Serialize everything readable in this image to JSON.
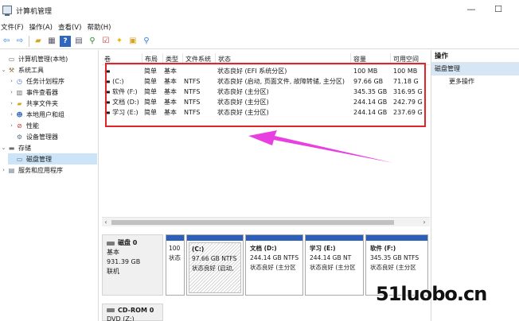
{
  "window": {
    "title": "计算机管理",
    "minimize": "—",
    "maximize": "☐"
  },
  "menu": [
    "文件(F)",
    "操作(A)",
    "查看(V)",
    "帮助(H)"
  ],
  "toolbar": [
    "back-icon",
    "forward-icon",
    "up-folder-icon",
    "show-tree-icon",
    "help-icon",
    "properties-icon",
    "connect-icon",
    "check-icon",
    "new-icon",
    "search-folder-icon",
    "zoom-icon"
  ],
  "nav": [
    {
      "label": "计算机管理(本地)",
      "level": 0,
      "arrow": "",
      "icon": "computer-icon"
    },
    {
      "label": "系统工具",
      "level": 1,
      "arrow": "⌄",
      "icon": "tools-icon"
    },
    {
      "label": "任务计划程序",
      "level": 2,
      "arrow": "›",
      "icon": "clock-icon"
    },
    {
      "label": "事件查看器",
      "level": 2,
      "arrow": "›",
      "icon": "event-icon"
    },
    {
      "label": "共享文件夹",
      "level": 2,
      "arrow": "›",
      "icon": "shared-folder-icon"
    },
    {
      "label": "本地用户和组",
      "level": 2,
      "arrow": "›",
      "icon": "users-icon"
    },
    {
      "label": "性能",
      "level": 2,
      "arrow": "›",
      "icon": "performance-icon"
    },
    {
      "label": "设备管理器",
      "level": 2,
      "arrow": "",
      "icon": "device-icon"
    },
    {
      "label": "存储",
      "level": 1,
      "arrow": "⌄",
      "icon": "storage-icon"
    },
    {
      "label": "磁盘管理",
      "level": 2,
      "arrow": "",
      "icon": "disk-icon",
      "selected": true
    },
    {
      "label": "服务和应用程序",
      "level": 1,
      "arrow": "›",
      "icon": "services-icon"
    }
  ],
  "columns": [
    "卷",
    "布局",
    "类型",
    "文件系统",
    "状态",
    "容量",
    "可用空间"
  ],
  "volumes": [
    {
      "name": "",
      "layout": "简单",
      "type": "基本",
      "fs": "",
      "status": "状态良好 (EFI 系统分区)",
      "capacity": "100 MB",
      "free": "100 MB"
    },
    {
      "name": "(C:)",
      "layout": "简单",
      "type": "基本",
      "fs": "NTFS",
      "status": "状态良好 (启动, 页面文件, 故障转储, 主分区)",
      "capacity": "97.66 GB",
      "free": "71.18 G"
    },
    {
      "name": "软件 (F:)",
      "layout": "简单",
      "type": "基本",
      "fs": "NTFS",
      "status": "状态良好 (主分区)",
      "capacity": "345.35 GB",
      "free": "316.95 G"
    },
    {
      "name": "文档 (D:)",
      "layout": "简单",
      "type": "基本",
      "fs": "NTFS",
      "status": "状态良好 (主分区)",
      "capacity": "244.14 GB",
      "free": "242.79 G"
    },
    {
      "name": "学习 (E:)",
      "layout": "简单",
      "type": "基本",
      "fs": "NTFS",
      "status": "状态良好 (主分区)",
      "capacity": "244.14 GB",
      "free": "237.69 G"
    }
  ],
  "disk0": {
    "name": "磁盘 0",
    "type": "基本",
    "size": "931.39 GB",
    "state": "联机",
    "partitions": [
      {
        "label": "",
        "size": "100",
        "status": "状态",
        "hatched": false
      },
      {
        "label": "(C:)",
        "size": "97.66 GB NTFS",
        "status": "状态良好 (启动,",
        "hatched": true
      },
      {
        "label": "文档  (D:)",
        "size": "244.14 GB NTFS",
        "status": "状态良好 (主分区",
        "hatched": false
      },
      {
        "label": "学习  (E:)",
        "size": "244.14 GB NT",
        "status": "状态良好 (主分区",
        "hatched": false
      },
      {
        "label": "软件  (F:)",
        "size": "345.35 GB NTFS",
        "status": "状态良好 (主分区",
        "hatched": false
      }
    ]
  },
  "cdrom": {
    "name": "CD-ROM 0",
    "type": "DVD (Z:)"
  },
  "actions": {
    "header": "操作",
    "section": "磁盘管理",
    "item": "更多操作"
  },
  "watermark": "51luobo.cn",
  "colors": {
    "highlight_box": "#e0242c",
    "arrow": "#e93fe0",
    "partition_bar": "#2c5fb8",
    "selected": "#cce4f7"
  }
}
